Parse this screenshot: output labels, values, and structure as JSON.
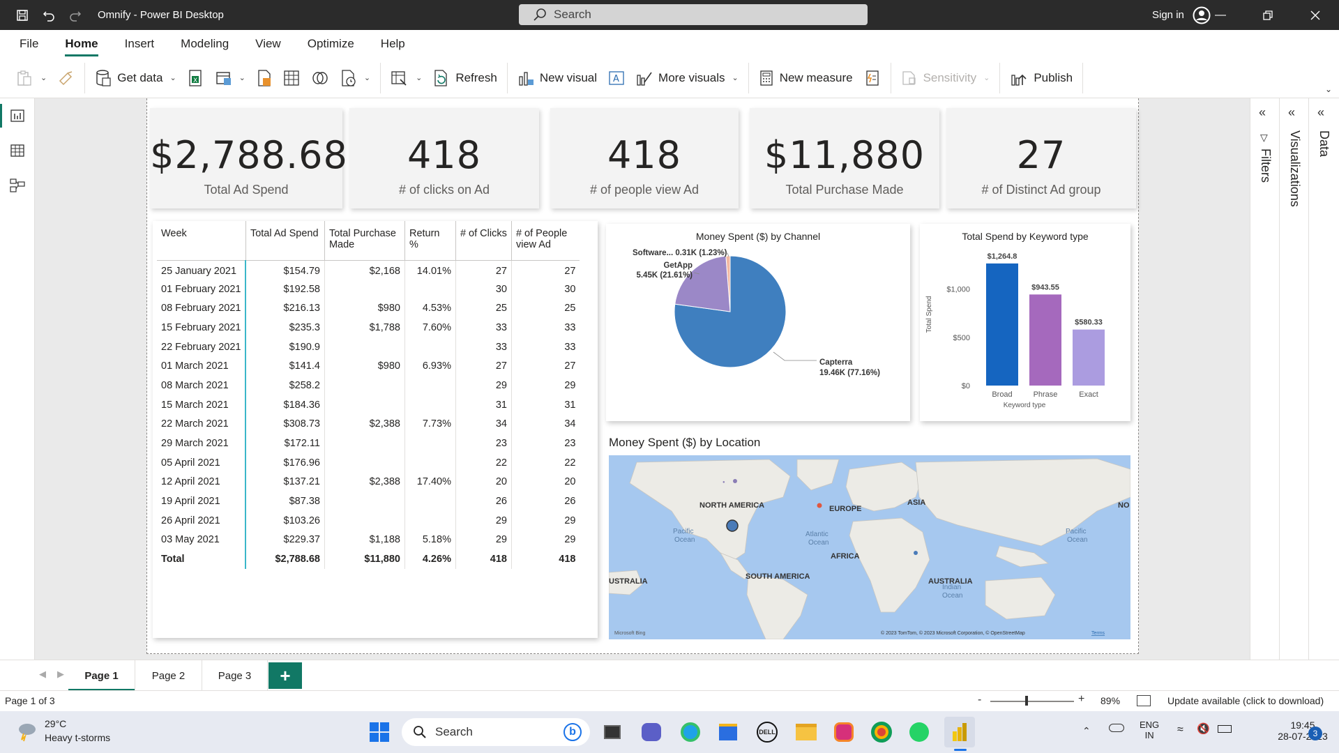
{
  "window": {
    "title": "Omnify - Power BI Desktop",
    "search_placeholder": "Search",
    "sign_in": "Sign in"
  },
  "menu": [
    "File",
    "Home",
    "Insert",
    "Modeling",
    "View",
    "Optimize",
    "Help"
  ],
  "ribbon": {
    "get_data": "Get data",
    "refresh": "Refresh",
    "new_visual": "New visual",
    "more_visuals": "More visuals",
    "new_measure": "New measure",
    "sensitivity": "Sensitivity",
    "publish": "Publish"
  },
  "kpis": [
    {
      "value": "$2,788.68",
      "label": "Total Ad Spend"
    },
    {
      "value": "418",
      "label": "# of clicks on Ad"
    },
    {
      "value": "418",
      "label": "# of people view Ad"
    },
    {
      "value": "$11,880",
      "label": "Total Purchase Made"
    },
    {
      "value": "27",
      "label": "# of Distinct Ad group"
    }
  ],
  "table": {
    "headers": [
      "Week",
      "Total Ad Spend",
      "Total Purchase Made",
      "Return %",
      "# of Clicks",
      "# of People view Ad"
    ],
    "rows": [
      [
        "25 January 2021",
        "$154.79",
        "$2,168",
        "14.01%",
        "27",
        "27"
      ],
      [
        "01 February 2021",
        "$192.58",
        "",
        "",
        "30",
        "30"
      ],
      [
        "08 February 2021",
        "$216.13",
        "$980",
        "4.53%",
        "25",
        "25"
      ],
      [
        "15 February 2021",
        "$235.3",
        "$1,788",
        "7.60%",
        "33",
        "33"
      ],
      [
        "22 February 2021",
        "$190.9",
        "",
        "",
        "33",
        "33"
      ],
      [
        "01 March 2021",
        "$141.4",
        "$980",
        "6.93%",
        "27",
        "27"
      ],
      [
        "08 March 2021",
        "$258.2",
        "",
        "",
        "29",
        "29"
      ],
      [
        "15 March 2021",
        "$184.36",
        "",
        "",
        "31",
        "31"
      ],
      [
        "22 March 2021",
        "$308.73",
        "$2,388",
        "7.73%",
        "34",
        "34"
      ],
      [
        "29 March 2021",
        "$172.11",
        "",
        "",
        "23",
        "23"
      ],
      [
        "05 April 2021",
        "$176.96",
        "",
        "",
        "22",
        "22"
      ],
      [
        "12 April 2021",
        "$137.21",
        "$2,388",
        "17.40%",
        "20",
        "20"
      ],
      [
        "19 April 2021",
        "$87.38",
        "",
        "",
        "26",
        "26"
      ],
      [
        "26 April 2021",
        "$103.26",
        "",
        "",
        "29",
        "29"
      ],
      [
        "03 May 2021",
        "$229.37",
        "$1,188",
        "5.18%",
        "29",
        "29"
      ]
    ],
    "total": [
      "Total",
      "$2,788.68",
      "$11,880",
      "4.26%",
      "418",
      "418"
    ]
  },
  "chart_data": [
    {
      "type": "pie",
      "title": "Money Spent ($) by Channel",
      "slices": [
        {
          "name": "Capterra",
          "value": 19.46,
          "label": "19.46K (77.16%)",
          "color": "#3f7fbf"
        },
        {
          "name": "GetApp",
          "value": 5.45,
          "label": "5.45K (21.61%)",
          "color": "#9b88c7"
        },
        {
          "name": "Software...",
          "value": 0.31,
          "label": "0.31K (1.23%)",
          "color": "#f2b8a2"
        }
      ]
    },
    {
      "type": "bar",
      "title": "Total Spend by Keyword type",
      "xlabel": "Keyword type",
      "ylabel": "Total Spend",
      "categories": [
        "Broad",
        "Phrase",
        "Exact"
      ],
      "values": [
        1264.8,
        943.55,
        580.33
      ],
      "value_labels": [
        "$1,264.8",
        "$943.55",
        "$580.33"
      ],
      "colors": [
        "#1565c0",
        "#a569bd",
        "#ab9ce0"
      ],
      "ylim": [
        0,
        1300
      ],
      "yticks": [
        0,
        500,
        1000
      ],
      "ytick_labels": [
        "$0",
        "$500",
        "$1,000"
      ]
    }
  ],
  "map": {
    "title": "Money Spent ($) by Location",
    "labels": [
      "NORTH AMERICA",
      "EUROPE",
      "ASIA",
      "AFRICA",
      "SOUTH AMERICA",
      "USTRALIA",
      "AUSTRALIA",
      "NO",
      "Pacific\nOcean",
      "Atlantic\nOcean",
      "Pacific\nOcean",
      "Indian\nOcean"
    ],
    "attribution_left": "Microsoft Bing",
    "attribution_right": "© 2023 TomTom, © 2023 Microsoft Corporation, © OpenStreetMap",
    "terms": "Terms"
  },
  "panes": {
    "filters": "Filters",
    "visualizations": "Visualizations",
    "data": "Data"
  },
  "pages": [
    "Page 1",
    "Page 2",
    "Page 3"
  ],
  "add_page": "+",
  "status": {
    "page_info": "Page 1 of 3",
    "zoom": "89%",
    "update": "Update available (click to download)"
  },
  "taskbar": {
    "temp": "29°C",
    "weather": "Heavy t-storms",
    "search": "Search",
    "lang1": "ENG",
    "lang2": "IN",
    "time": "19:45",
    "date": "28-07-2023",
    "notif": "3"
  }
}
